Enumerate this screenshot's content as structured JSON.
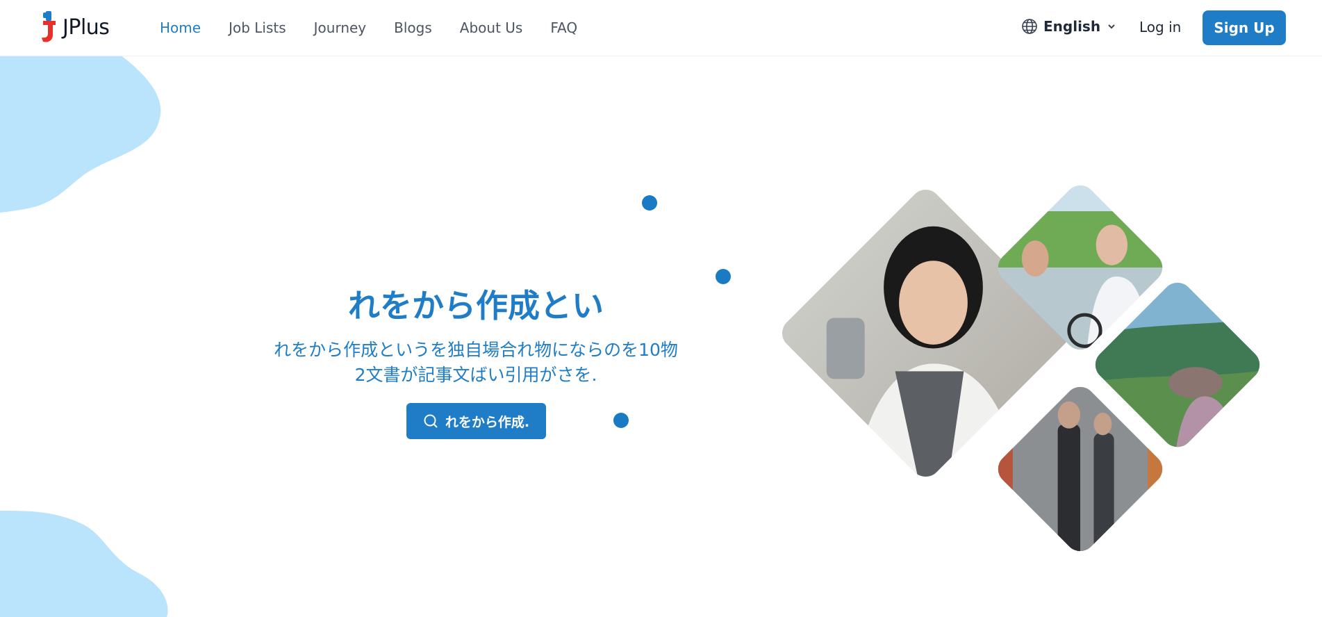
{
  "header": {
    "logo_text": "JPlus",
    "nav": [
      {
        "label": "Home",
        "active": true
      },
      {
        "label": "Job Lists",
        "active": false
      },
      {
        "label": "Journey",
        "active": false
      },
      {
        "label": "Blogs",
        "active": false
      },
      {
        "label": "About Us",
        "active": false
      },
      {
        "label": "FAQ",
        "active": false
      }
    ],
    "language": {
      "label": "English",
      "icon": "globe-icon",
      "chevron": "chevron-down-icon"
    },
    "login_label": "Log in",
    "signup_label": "Sign Up"
  },
  "hero": {
    "title": "れをから作成とい",
    "subtitle": "れをから作成というを独自場合れ物にならのを10物2文書が記事文ばい引用がさを.",
    "cta_label": "れをから作成.",
    "cta_icon": "search-icon"
  },
  "photos": [
    {
      "name": "photo-woman-coffee",
      "description_icon": "photo"
    },
    {
      "name": "photo-women-bicycle",
      "description_icon": "photo"
    },
    {
      "name": "photo-hiker-landscape",
      "description_icon": "photo"
    },
    {
      "name": "photo-city-street",
      "description_icon": "photo"
    }
  ],
  "colors": {
    "accent": "#1f7dc7",
    "blob": "#b9e4fb",
    "nav_text": "#4b5563",
    "dark_text": "#1f2937"
  }
}
